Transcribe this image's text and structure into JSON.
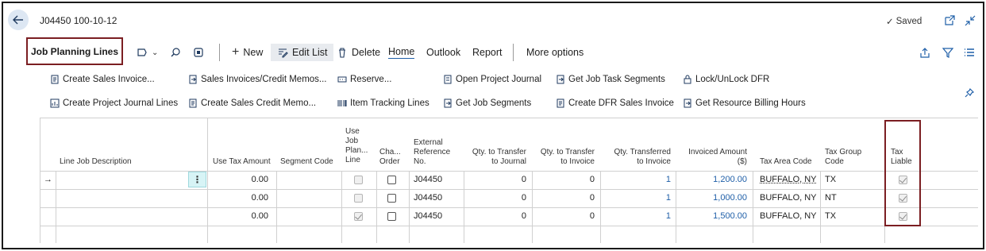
{
  "header": {
    "doc_title": "J04450 100-10-12",
    "saved_label": "Saved"
  },
  "tab": {
    "label": "Job Planning Lines"
  },
  "actions": {
    "new": "New",
    "edit_list": "Edit List",
    "delete": "Delete",
    "home": "Home",
    "outlook": "Outlook",
    "report": "Report",
    "more_options": "More options"
  },
  "promoted": [
    "Create Sales Invoice...",
    "Sales Invoices/Credit Memos...",
    "Reserve...",
    "Open Project Journal",
    "Get Job Task Segments",
    "Lock/UnLock DFR",
    "Create Project Journal Lines",
    "Create Sales Credit Memo...",
    "Item Tracking Lines",
    "Get Job Segments",
    "Create DFR Sales Invoice",
    "Get Resource Billing Hours"
  ],
  "columns": {
    "line_job_description": "Line Job Description",
    "use_tax_amount": "Use Tax Amount",
    "segment_code": "Segment Code",
    "use_job_plan_line": [
      "Use",
      "Job",
      "Plan...",
      "Line"
    ],
    "change_order": [
      "Cha...",
      "Order"
    ],
    "external_reference": [
      "External",
      "Reference",
      "No."
    ],
    "qty_transfer_journal": [
      "Qty. to Transfer",
      "to Journal"
    ],
    "qty_transfer_invoice": [
      "Qty. to Transfer",
      "to Invoice"
    ],
    "qty_transferred_invoice": [
      "Qty. Transferred",
      "to Invoice"
    ],
    "invoiced_amount": [
      "Invoiced Amount",
      "($)"
    ],
    "tax_area_code": "Tax Area Code",
    "tax_group_code": [
      "Tax Group",
      "Code"
    ],
    "tax_liable": [
      "Tax",
      "Liable"
    ]
  },
  "rows": [
    {
      "use_tax_amount": "0.00",
      "use_job_plan_line": false,
      "change_order": false,
      "external_ref": "J04450",
      "qty_journal": "0",
      "qty_invoice": "0",
      "qty_transferred": "1",
      "invoiced_amount": "1,200.00",
      "tax_area": "BUFFALO, NY",
      "tax_group": "TX",
      "tax_liable": true
    },
    {
      "use_tax_amount": "0.00",
      "use_job_plan_line": false,
      "change_order": false,
      "external_ref": "J04450",
      "qty_journal": "0",
      "qty_invoice": "0",
      "qty_transferred": "1",
      "invoiced_amount": "1,000.00",
      "tax_area": "BUFFALO, NY",
      "tax_group": "NT",
      "tax_liable": true
    },
    {
      "use_tax_amount": "0.00",
      "use_job_plan_line": true,
      "change_order": false,
      "external_ref": "J04450",
      "qty_journal": "0",
      "qty_invoice": "0",
      "qty_transferred": "1",
      "invoiced_amount": "1,500.00",
      "tax_area": "BUFFALO, NY",
      "tax_group": "TX",
      "tax_liable": true
    }
  ],
  "colors": {
    "accent": "#1f5fa8",
    "highlight_box": "#7b1e22",
    "selected_cell": "#d7f4f6"
  }
}
